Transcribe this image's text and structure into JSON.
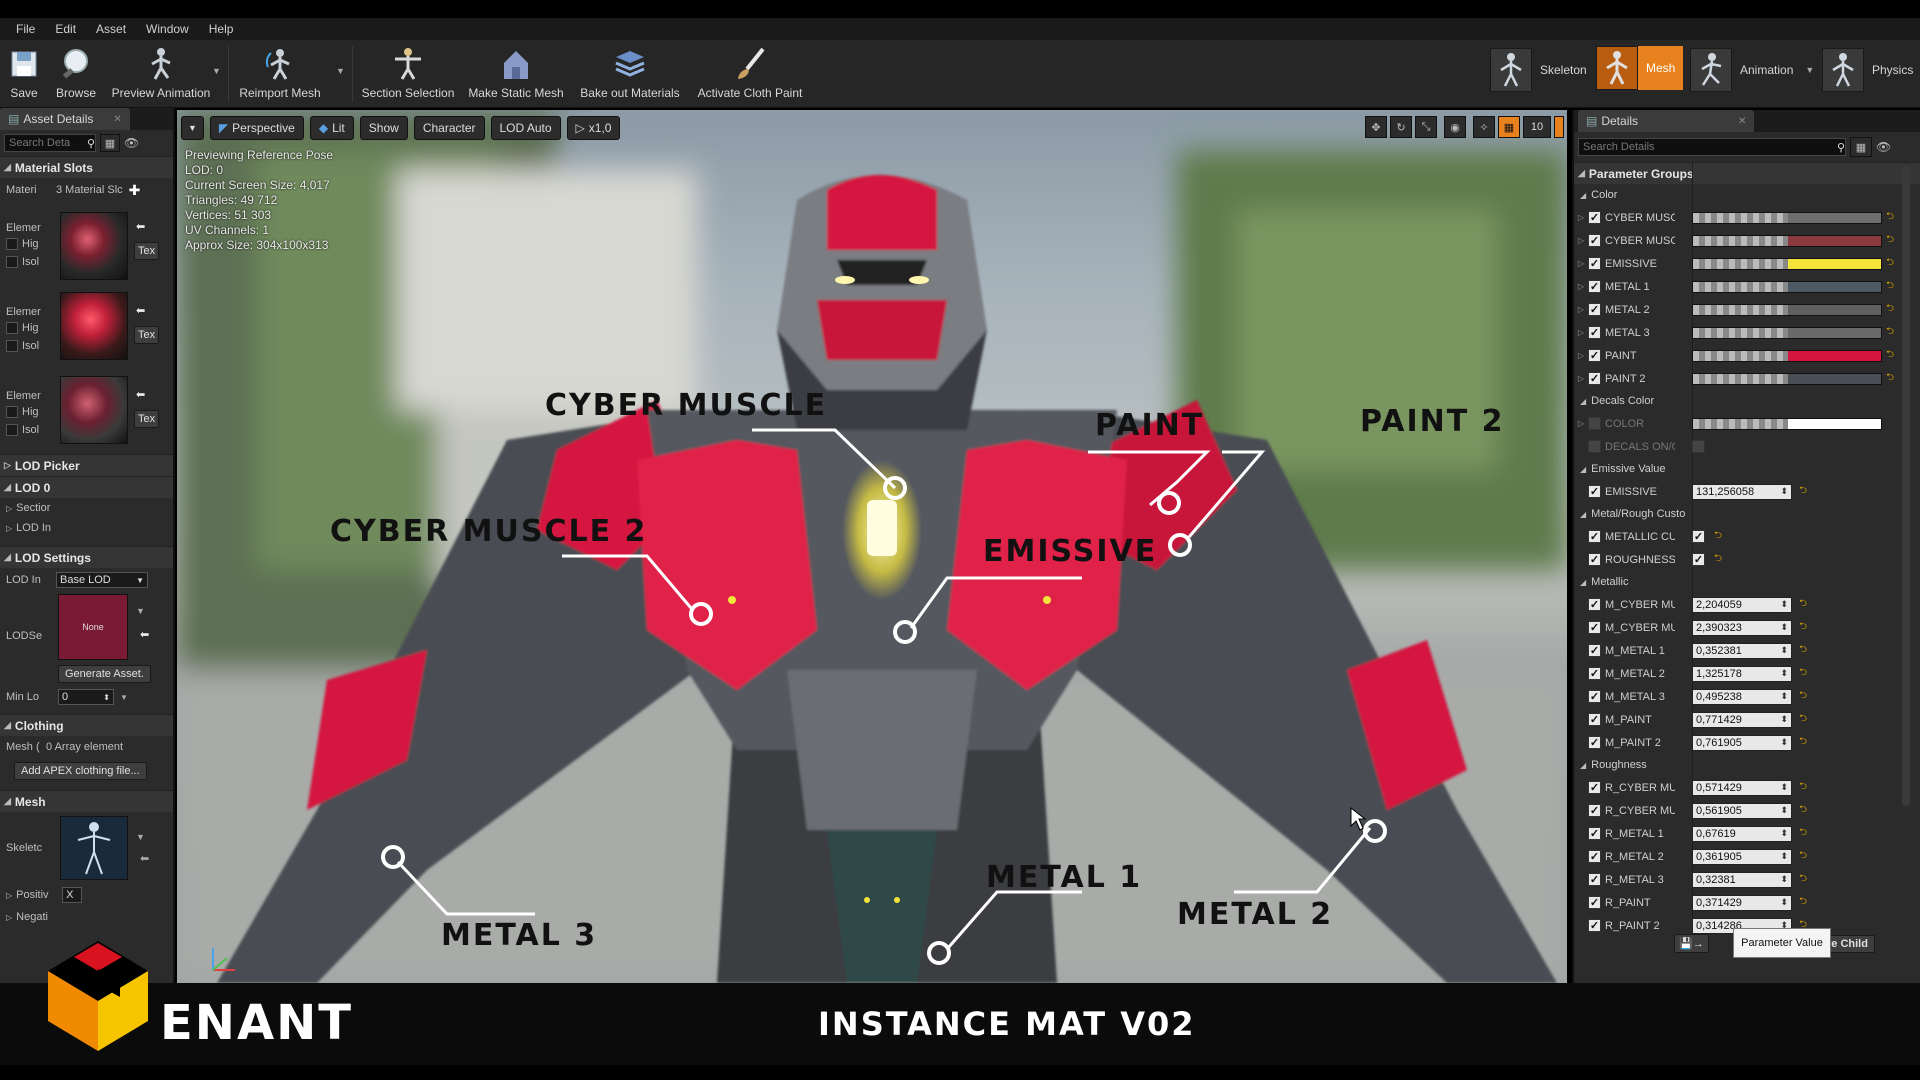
{
  "menu": [
    "File",
    "Edit",
    "Asset",
    "Window",
    "Help"
  ],
  "toolbar": {
    "save": "Save",
    "browse": "Browse",
    "preview_animation": "Preview Animation",
    "reimport_mesh": "Reimport Mesh",
    "section_selection": "Section Selection",
    "make_static_mesh": "Make Static Mesh",
    "bake_out_materials": "Bake out Materials",
    "activate_cloth_paint": "Activate Cloth Paint"
  },
  "modes": {
    "skeleton": "Skeleton",
    "mesh": "Mesh",
    "animation": "Animation",
    "physics": "Physics"
  },
  "left_panel": {
    "tab": "Asset Details",
    "search_placeholder": "Search Deta",
    "material_slots": "Material Slots",
    "materials_label": "Materi",
    "materials_value": "3 Material Slc",
    "element_label": "Elemer",
    "highlight": "Hig",
    "isolate": "Isol",
    "textures_btn": "Tex",
    "lod_picker": "LOD Picker",
    "lod0": "LOD 0",
    "sections": "Sectior",
    "lod_info": "LOD In",
    "lod_settings": "LOD Settings",
    "lod_import_label": "LOD In",
    "lod_import_value": "Base LOD",
    "lod_setting_label": "LODSe",
    "lod_setting_none": "None",
    "generate_asset": "Generate Asset.",
    "min_lod_label": "Min Lo",
    "min_lod_value": "0",
    "clothing": "Clothing",
    "mesh_clothing_label": "Mesh (",
    "mesh_clothing_value": "0 Array element",
    "add_apex": "Add APEX clothing file...",
    "mesh": "Mesh",
    "skeleton_label": "Skeletc",
    "positive_label": "Positiv",
    "positive_value": "X",
    "negative_label": "Negati"
  },
  "viewport": {
    "perspective": "Perspective",
    "lit": "Lit",
    "show": "Show",
    "character": "Character",
    "lod_auto": "LOD Auto",
    "speed": "x1,0",
    "grid_snap": "10",
    "info": [
      "Previewing Reference Pose",
      "LOD: 0",
      "Current Screen Size: 4,017",
      "Triangles: 49 712",
      "Vertices: 51 303",
      "UV Channels: 1",
      "Approx Size: 304x100x313"
    ],
    "callouts": {
      "cyber_muscle": "CYBER MUSCLE",
      "cyber_muscle_2": "CYBER MUSCLE 2",
      "paint": "PAINT",
      "paint_2": "PAINT 2",
      "emissive": "EMISSIVE",
      "metal_1": "METAL 1",
      "metal_2": "METAL 2",
      "metal_3": "METAL 3"
    }
  },
  "right_panel": {
    "tab": "Details",
    "search_placeholder": "Search Details",
    "parameter_groups": "Parameter Groups",
    "color_group": "Color",
    "colors": [
      {
        "name": "CYBER MUSCL",
        "color": "#6f6f6f"
      },
      {
        "name": "CYBER MUSCL",
        "color": "#8a3a3e"
      },
      {
        "name": "EMISSIVE",
        "color": "#f4e43a"
      },
      {
        "name": "METAL 1",
        "color": "#4d5a66"
      },
      {
        "name": "METAL 2",
        "color": "#5f5f5f"
      },
      {
        "name": "METAL 3",
        "color": "#6a6a6a"
      },
      {
        "name": "PAINT",
        "color": "#d4163f"
      },
      {
        "name": "PAINT 2",
        "color": "#4a4e56"
      }
    ],
    "decals_group": "Decals Color",
    "decal_color": {
      "name": "COLOR",
      "color": "#ffffff"
    },
    "decal_onoff": "DECALS ON/O",
    "emissive_group": "Emissive Value",
    "emissive": {
      "name": "EMISSIVE",
      "value": "131,256058"
    },
    "metal_rough_group": "Metal/Rough Custo",
    "metallic_custom": "METALLIC CUS",
    "roughness_custom": "ROUGHNESS C",
    "metallic_group": "Metallic",
    "metallic": [
      {
        "name": "M_CYBER MUS",
        "value": "2,204059"
      },
      {
        "name": "M_CYBER MUS",
        "value": "2,390323"
      },
      {
        "name": "M_METAL 1",
        "value": "0,352381"
      },
      {
        "name": "M_METAL 2",
        "value": "1,325178"
      },
      {
        "name": "M_METAL 3",
        "value": "0,495238"
      },
      {
        "name": "M_PAINT",
        "value": "0,771429"
      },
      {
        "name": "M_PAINT 2",
        "value": "0,761905"
      }
    ],
    "roughness_group": "Roughness",
    "roughness": [
      {
        "name": "R_CYBER MUS",
        "value": "0,571429"
      },
      {
        "name": "R_CYBER MUS",
        "value": "0,561905"
      },
      {
        "name": "R_METAL 1",
        "value": "0,67619"
      },
      {
        "name": "R_METAL 2",
        "value": "0,361905"
      },
      {
        "name": "R_METAL 3",
        "value": "0,32381"
      },
      {
        "name": "R_PAINT",
        "value": "0,371429"
      },
      {
        "name": "R_PAINT 2",
        "value": "0,314286"
      }
    ],
    "save_child": "Save Child",
    "tooltip": "Parameter Value"
  },
  "banner": {
    "brand": "ENANT",
    "title": "INSTANCE MAT V02"
  },
  "colors": {
    "accent_orange": "#e8821e",
    "paint_red": "#d4163f",
    "emissive_yellow": "#f4e43a",
    "logo_red": "#d8121e",
    "logo_orange": "#f08a00",
    "logo_yellow": "#f7c400"
  }
}
